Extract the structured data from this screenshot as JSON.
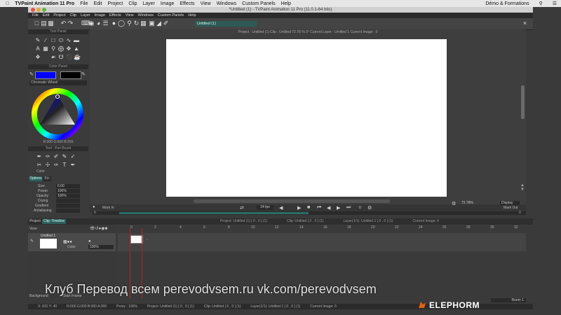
{
  "os_menubar": {
    "app_name": "TVPaint Animation 11 Pro",
    "items": [
      "File",
      "Edit",
      "Project",
      "Clip",
      "Layer",
      "Image",
      "Effects",
      "View",
      "Windows",
      "Custom Panels",
      "Help"
    ],
    "user": "Démo & Formations"
  },
  "window": {
    "title": "*Untitled (1) - TVPaint Animation 11 Pro (11.0.1-64 bits)"
  },
  "app_menu": {
    "items": [
      "File",
      "Edit",
      "Project",
      "Clip",
      "Layer",
      "Image",
      "Effects",
      "View",
      "Windows",
      "Custom Panels",
      "Help"
    ]
  },
  "toolbar": {
    "layer_field": "Untitled (1)"
  },
  "canvas": {
    "info": "Project : Untitled (1)    Clip : Untitled    72.78 %    0°    Current Layer : Untitled 1    Current Image : 0",
    "zoom": "72.78%",
    "display_label": "Display"
  },
  "left_panel": {
    "tools_title": "Tool Panel",
    "color_title": "Color Panel",
    "wheel_mode": "Chromatic Wheel",
    "rgb_readout": "R:000 G:000 B:255",
    "pen_title": "Tool : Pen Brush",
    "color_label": "Color",
    "tabs": [
      "Options",
      "Bin"
    ],
    "params": [
      {
        "label": "Size",
        "value": "6.00"
      },
      {
        "label": "Power",
        "value": "100%"
      },
      {
        "label": "Opacity",
        "value": "100%"
      },
      {
        "label": "Drying",
        "value": ""
      },
      {
        "label": "Gradient",
        "value": ""
      },
      {
        "label": "Antialiasing",
        "value": ""
      }
    ],
    "primary_color": "#0000ff",
    "secondary_color": "#000000"
  },
  "playback": {
    "mark_in": "Mark In",
    "mark_out": "Mark Out",
    "fps": "24 fps",
    "frame_start": "0",
    "frame_end": "0",
    "current_frame": "0"
  },
  "timeline": {
    "tabs": [
      "Project",
      "Clip: Timeline"
    ],
    "info_project": "Project: Untitled (1) [ 0 , 0 ] (1)",
    "info_clip": "Clip: Untitled [ 0 , 0 ] (1)",
    "info_layer": "Layer(1/1): Untitled 1 [ 0 , 0 ] (1)",
    "info_image": "Current Image: 0",
    "view_label": "View",
    "layer_name": "Untitled 1",
    "layer_color_label": "Color",
    "layer_opacity": "100%",
    "ruler": [
      "0",
      "2",
      "4",
      "6",
      "8",
      "10",
      "12",
      "14",
      "16",
      "18",
      "20",
      "22",
      "24",
      "26",
      "28",
      "30",
      "32"
    ],
    "background_label": "Background",
    "start_frame_label": "Start Frame",
    "room_label": "Room 1"
  },
  "status_bar": {
    "coords": "X: 631  Y: 40",
    "rgb": "R:000 G:000 B:000 A:000",
    "proxy": "Proxy : 100%",
    "project": "Project: Untitled (1) [ 0 , 0 ] (1)",
    "clip": "Clip: Untitled [ 0 , 0 ] (1)",
    "layer": "Layer(1/1): Untitled 1 [ 0 , 0 ] (1)",
    "image": "Current Image: 0"
  },
  "watermark": {
    "text": "Клуб Перевод всем   perevodvsem.ru  vk.com/perevodvsem",
    "logo": "ELEPHORM"
  }
}
